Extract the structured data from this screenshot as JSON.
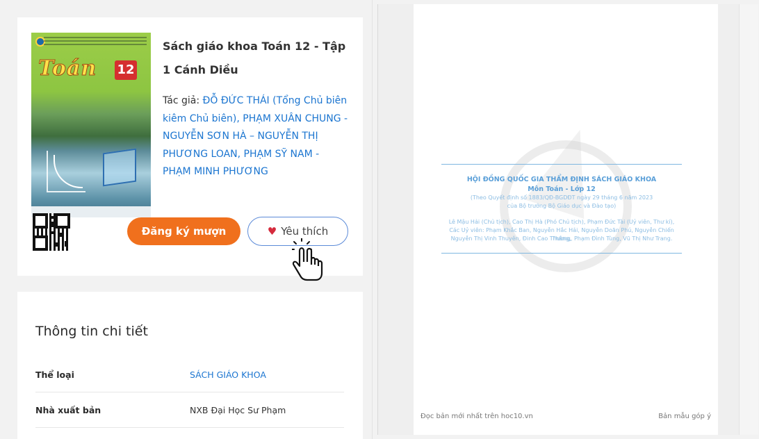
{
  "book": {
    "title": "Sách giáo khoa Toán 12 - Tập 1 Cánh Diều",
    "author_label": "Tác giả:",
    "authors": "ĐỖ ĐỨC THÁI (Tổng Chủ biên kiêm Chủ biên), PHẠM XUÂN CHUNG - NGUYỄN SƠN HÀ – NGUYỄN THỊ PHƯƠNG LOAN, PHẠM SỸ NAM - PHẠM MINH PHƯƠNG",
    "cover_title": "Toán",
    "cover_number": "12"
  },
  "actions": {
    "borrow_label": "Đăng ký mượn",
    "like_label": "Yêu thích"
  },
  "details": {
    "heading": "Thông tin chi tiết",
    "rows": [
      {
        "key": "Thể loại",
        "value": "SÁCH GIÁO KHOA"
      },
      {
        "key": "Nhà xuất bản",
        "value": "NXB Đại Học Sư Phạm"
      }
    ]
  },
  "viewer": {
    "page_heading": "HỘI ĐỒNG QUỐC GIA THẨM ĐỊNH SÁCH GIÁO KHOA",
    "page_subject": "Môn Toán - Lớp 12",
    "page_decision": "(Theo Quyết định số 1883/QĐ-BGDĐT ngày 29 tháng 6 năm 2023",
    "page_decision2": "của Bộ trưởng Bộ Giáo dục và Đào tạo)",
    "page_members1": "Lê Mậu Hải (Chủ tịch), Cao Thị Hà (Phó Chủ tịch), Phạm Đức Tài (Uỷ viên, Thư kí),",
    "page_members2": "Các Uỷ viên: Phạm Khắc Ban, Nguyễn Hắc Hải, Nguyễn Doãn Phú, Nguyễn Chiến Thắng,",
    "page_members3": "Nguyễn Thị Vinh Thuyên, Đinh Cao Thương, Phạm Đình Tùng, Vũ Thị Như Trang.",
    "footer_left": "Đọc bản mới nhất trên hoc10.vn",
    "footer_right": "Bản mẫu góp ý"
  },
  "colors": {
    "accent_orange": "#f0701d",
    "link_blue": "#1b75d0",
    "heart_red": "#d52b3d"
  },
  "icons": [
    "heart-icon",
    "hand-pointer-icon",
    "qr-code-icon"
  ]
}
